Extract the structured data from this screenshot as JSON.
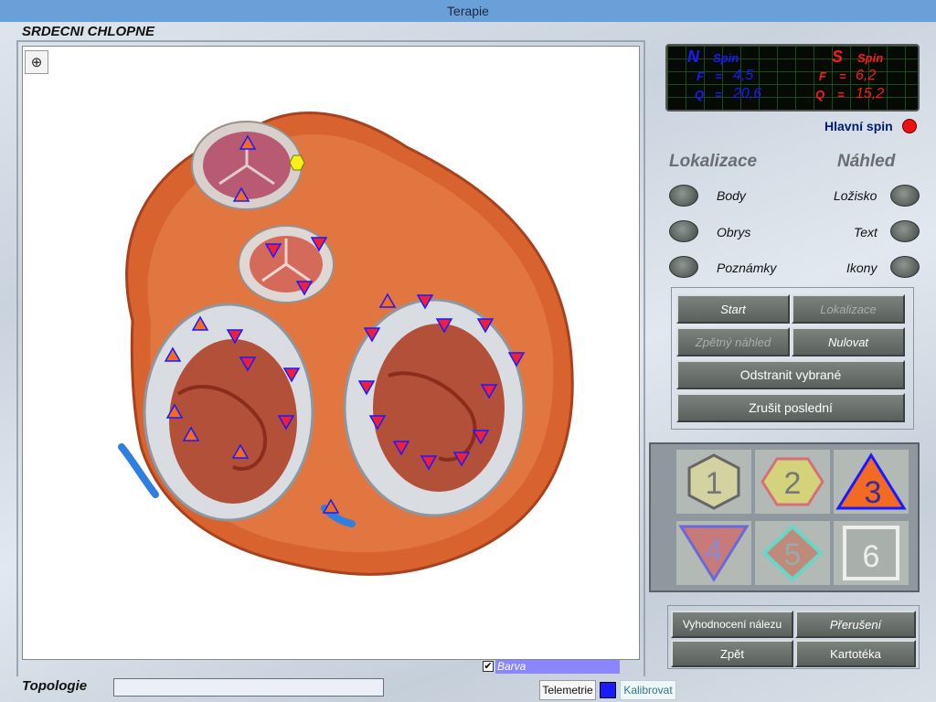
{
  "window": {
    "title": "Terapie"
  },
  "section_title": "SRDECNI CHLOPNE",
  "telemetry": {
    "north": {
      "pole": "N",
      "label": "Spin",
      "f_label": "F",
      "f_value": "4,5",
      "q_label": "Q",
      "q_value": "20,6"
    },
    "south": {
      "pole": "S",
      "label": "Spin",
      "f_label": "F",
      "f_value": "6,2",
      "q_label": "Q",
      "q_value": "15,2"
    },
    "eq": "="
  },
  "main_spin_label": "Hlavní spin",
  "lokalizace": {
    "header": "Lokalizace",
    "options": [
      "Body",
      "Obrys",
      "Poznámky"
    ]
  },
  "nahled": {
    "header": "Náhled",
    "options": [
      "Ložisko",
      "Text",
      "Ikony"
    ]
  },
  "actions": {
    "start": "Start",
    "lokalizace": "Lokalizace",
    "zpetny_nahled": "Zpětný náhled",
    "nulovat": "Nulovat",
    "odstranit": "Odstranit vybrané",
    "zrusit": "Zrušit poslední"
  },
  "marker_icons": [
    "1",
    "2",
    "3",
    "4",
    "5",
    "6"
  ],
  "bottom_buttons": {
    "vyhodnoceni": "Vyhodnocení nálezu",
    "preruseni": "Přerušení",
    "zpet": "Zpět",
    "kartoteka": "Kartotéka"
  },
  "barva_label": "Barva",
  "barva_checked": "✔",
  "topologie_label": "Topologie",
  "topologie_value": "",
  "telemetrie_button": "Telemetrie",
  "kalibrovat_button": "Kalibrovat",
  "colors": {
    "north": "#1a1aff",
    "south": "#ff1a1a",
    "selected_color": "#1a1aff",
    "accent": "#6aa0d8"
  }
}
